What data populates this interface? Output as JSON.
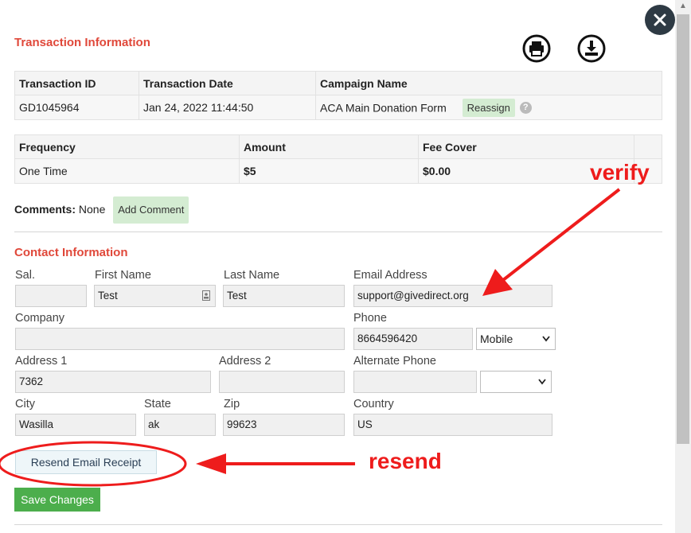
{
  "transaction": {
    "section_title": "Transaction Information",
    "headers": [
      "Transaction ID",
      "Transaction Date",
      "Campaign Name"
    ],
    "id": "GD1045964",
    "date": "Jan 24, 2022 11:44:50",
    "campaign": "ACA Main Donation Form",
    "reassign_label": "Reassign",
    "help_glyph": "?"
  },
  "amounts": {
    "headers": [
      "Frequency",
      "Amount",
      "Fee Cover"
    ],
    "frequency": "One Time",
    "amount": "$5",
    "fee_cover": "$0.00"
  },
  "comments": {
    "label": "Comments:",
    "value": "None",
    "add_label": "Add Comment"
  },
  "contact": {
    "section_title": "Contact Information",
    "labels": {
      "sal": "Sal.",
      "first_name": "First Name",
      "last_name": "Last Name",
      "email": "Email Address",
      "company": "Company",
      "phone": "Phone",
      "address1": "Address 1",
      "address2": "Address 2",
      "alt_phone": "Alternate Phone",
      "city": "City",
      "state": "State",
      "zip": "Zip",
      "country": "Country"
    },
    "values": {
      "sal": "",
      "first_name": "Test",
      "last_name": "Test",
      "email": "support@givedirect.org",
      "company": "",
      "phone": "8664596420",
      "phone_type": "Mobile",
      "address1": "7362",
      "address2": "",
      "alt_phone": "",
      "alt_phone_type": "",
      "city": "Wasilla",
      "state": "ak",
      "zip": "99623",
      "country": "US"
    }
  },
  "buttons": {
    "resend": "Resend Email Receipt",
    "save": "Save Changes"
  },
  "annotations": {
    "verify": "verify",
    "resend": "resend"
  },
  "icons": [
    "close-icon",
    "print-icon",
    "download-icon",
    "help-icon",
    "contact-card-icon",
    "chevron-down-icon"
  ],
  "colors": {
    "accent": "#e0483a",
    "save_button": "#4cae4c",
    "annotation": "#ee1c1c"
  }
}
